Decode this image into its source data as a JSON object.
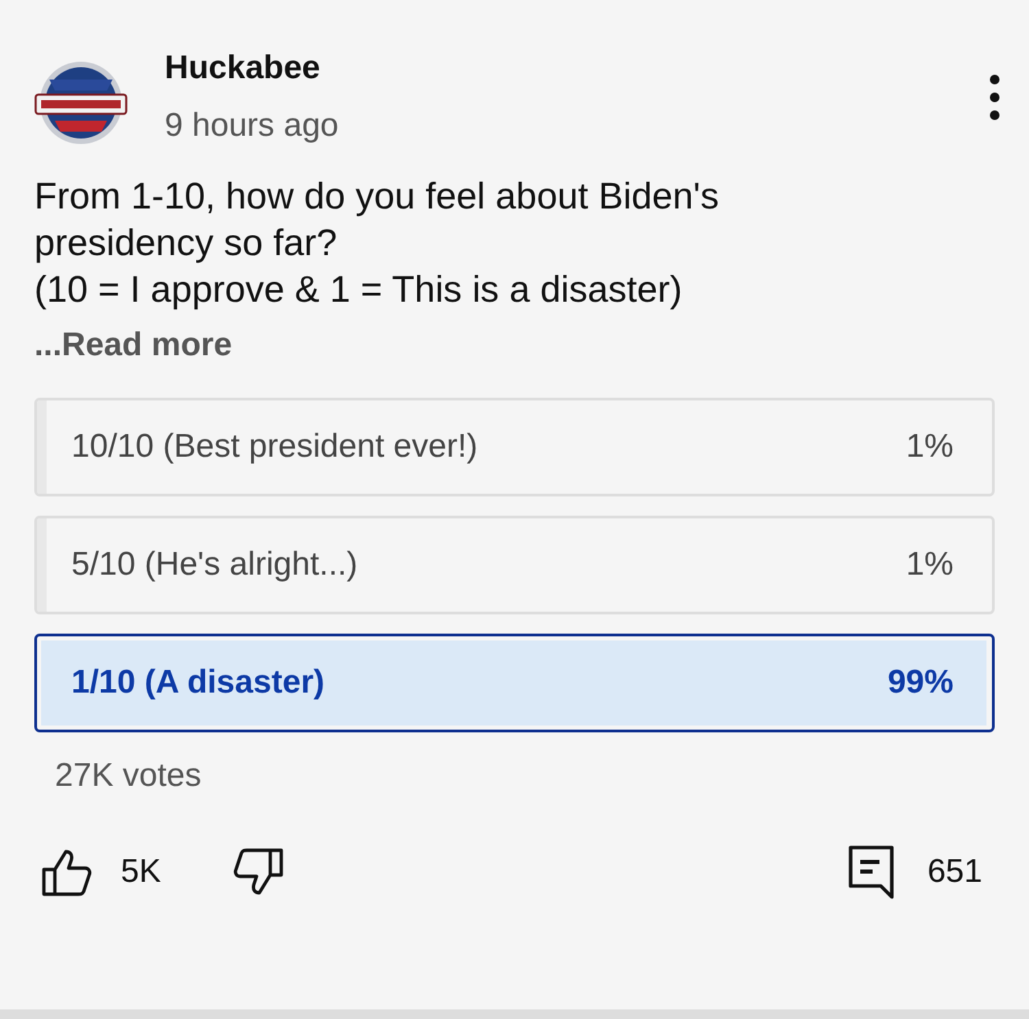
{
  "post": {
    "channel": "Huckabee",
    "time": "9 hours ago",
    "question_lines": [
      "From 1-10, how do you feel about Biden's",
      "presidency so far?",
      "(10 = I approve & 1 = This is a disaster)"
    ],
    "read_more": "...Read more"
  },
  "poll": {
    "options": [
      {
        "label": "10/10 (Best president ever!)",
        "percent": "1%",
        "level": 0.01,
        "selected": false
      },
      {
        "label": "5/10 (He's alright...)",
        "percent": "1%",
        "level": 0.01,
        "selected": false
      },
      {
        "label": "1/10 (A disaster)",
        "percent": "99%",
        "level": 0.99,
        "selected": true
      }
    ],
    "votes": "27K votes"
  },
  "actions": {
    "likes": "5K",
    "comments": "651"
  }
}
